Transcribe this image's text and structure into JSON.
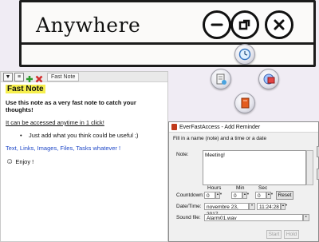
{
  "sketch_window": {
    "title": "Anywhere",
    "controls": {
      "minimize": "minus-icon",
      "restore": "restore-icon",
      "close": "close-icon"
    }
  },
  "launcher_icons": [
    "clock-icon",
    "notes-icon",
    "reminder-icon",
    "book-icon"
  ],
  "fast_note": {
    "toolbar": {
      "tab_label": "Fast Note"
    },
    "title": "Fast Note",
    "line1": "Use this note as a very fast note to catch your thoughts!",
    "line2": "It can be accessed anytime in 1 click!",
    "bullet": "Just add what you think could be useful ;)",
    "line4": "Text, Links, Images, Files, Tasks whatever !",
    "enjoy": "Enjoy !"
  },
  "reminder_dialog": {
    "title": "EverFastAccess - Add Reminder",
    "hint": "Fill in a name (note) and a time or a date",
    "note_label": "Note:",
    "note_value": "Meeting!",
    "hours_label": "Hours",
    "min_label": "Min",
    "sec_label": "Sec",
    "countdown_label": "Countdown:",
    "hours_value": "0",
    "min_value": "0",
    "sec_value": "0",
    "reset_label": "Reset",
    "datetime_label": "Date/Time:",
    "date_value": "novembre 23, 2017",
    "time_value": "11:24:28",
    "sound_label": "Sound file:",
    "sound_value": "Alarm01.wav",
    "start_label": "Start",
    "hold_label": "Hold"
  },
  "colors": {
    "note_title_highlight": "#f6ef4d",
    "link_blue": "#1f48c7",
    "dialog_bg": "#f0f0f0"
  }
}
